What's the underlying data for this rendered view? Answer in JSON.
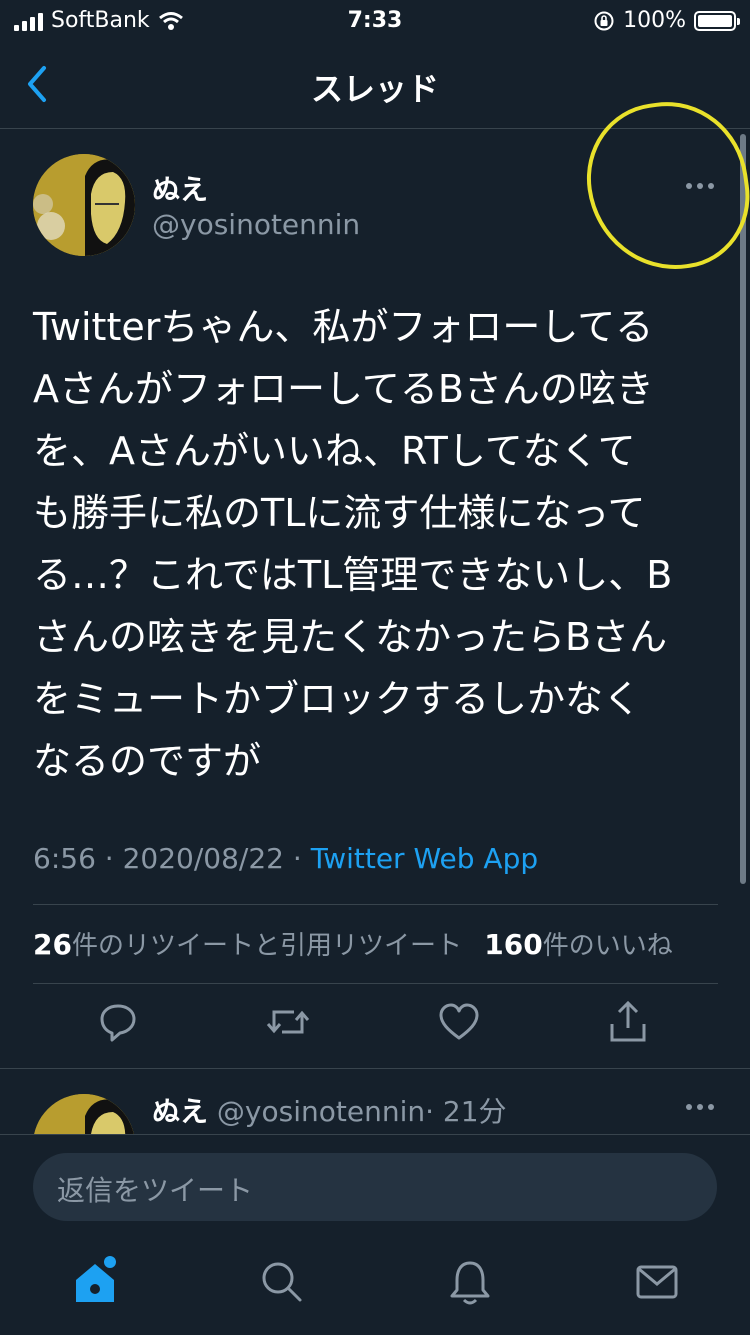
{
  "status_bar": {
    "carrier": "SoftBank",
    "time": "7:33",
    "battery": "100%"
  },
  "header": {
    "title": "スレッド"
  },
  "tweet": {
    "author_name": "ぬえ",
    "author_handle": "@yosinotennin",
    "text": "Twitterちゃん、私がフォローしてる\nAさんがフォローしてるBさんの呟き\nを、Aさんがいいね、RTしてなくて\nも勝手に私のTLに流す仕様になって\nる…？これではTL管理できないし、B\nさんの呟きを見たくなかったらBさん\nをミュートかブロックするしかなく\nなるのですが",
    "time": "6:56",
    "date": "2020/08/22",
    "sep": "·",
    "app": "Twitter Web App",
    "retweet_count": "26",
    "retweet_label": "件のリツイートと引用リツイート",
    "like_count": "160",
    "like_label": "件のいいね"
  },
  "reply": {
    "author_name": "ぬえ",
    "author_handle": "@yosinotennin",
    "age": "· 21分"
  },
  "composer": {
    "placeholder": "返信をツイート"
  },
  "tabbar": {
    "items": [
      "home-icon",
      "search-icon",
      "notifications-icon",
      "messages-icon"
    ]
  },
  "colors": {
    "background": "#15202b",
    "accent": "#1da1f2",
    "secondary_text": "#8b98a5",
    "annotation": "#e9e12b"
  }
}
